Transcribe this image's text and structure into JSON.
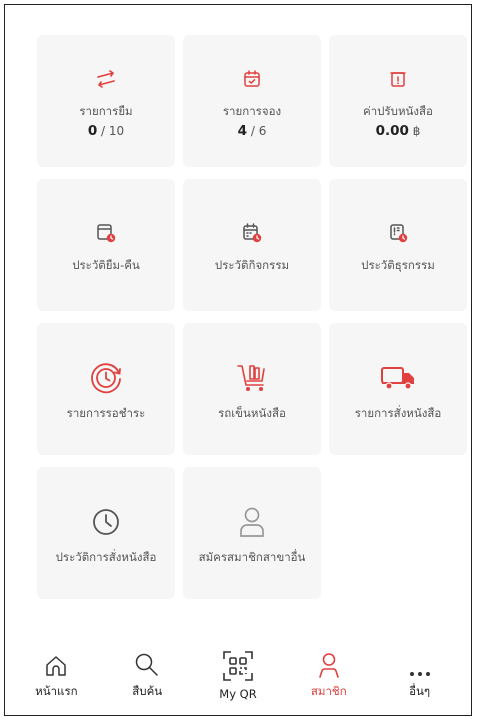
{
  "tiles": [
    {
      "label": "รายการยืม",
      "value": "0",
      "total": " / 10",
      "icon": "swap-arrows-icon"
    },
    {
      "label": "รายการจอง",
      "value": "4",
      "total": " / 6",
      "icon": "calendar-check-icon"
    },
    {
      "label": "ค่าปรับหนังสือ",
      "value": "0.00",
      "total": " ฿",
      "icon": "fine-notice-icon"
    },
    {
      "label": "ประวัติยืม-คืน",
      "icon": "borrow-history-icon"
    },
    {
      "label": "ประวัติกิจกรรม",
      "icon": "activity-history-icon"
    },
    {
      "label": "ประวัติธุรกรรม",
      "icon": "transaction-history-icon"
    },
    {
      "label": "รายการรอชำระ",
      "icon": "pending-payment-icon"
    },
    {
      "label": "รถเข็นหนังสือ",
      "icon": "book-cart-icon"
    },
    {
      "label": "รายการสั่งหนังสือ",
      "icon": "delivery-truck-icon"
    },
    {
      "label": "ประวัติการสั่งหนังสือ",
      "icon": "clock-icon"
    },
    {
      "label": "สมัครสมาชิกสาขาอื่น",
      "icon": "user-profile-icon"
    }
  ],
  "tabs": [
    {
      "label": "หน้าแรก",
      "icon": "home-icon"
    },
    {
      "label": "สืบค้น",
      "icon": "search-icon"
    },
    {
      "label": "My QR",
      "icon": "qr-code-icon"
    },
    {
      "label": "สมาชิก",
      "icon": "member-icon",
      "active": true
    },
    {
      "label": "อื่นๆ",
      "icon": "more-dots-icon"
    }
  ],
  "colors": {
    "accent": "#e0403f",
    "tile_bg": "#f6f6f6"
  }
}
